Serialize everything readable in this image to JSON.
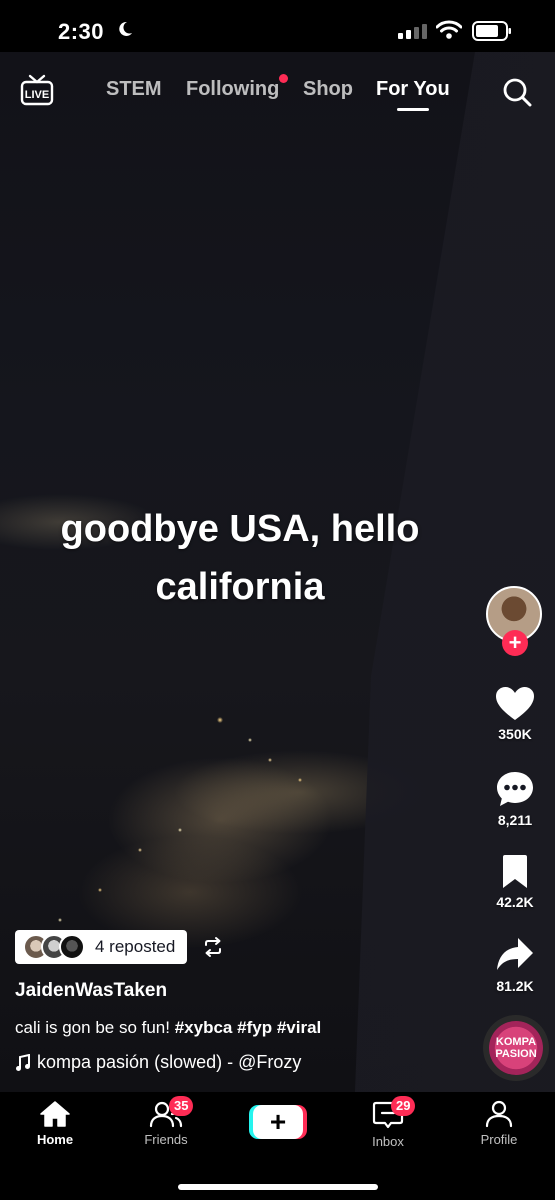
{
  "status_bar": {
    "time": "2:30",
    "moon_icon": "moon-icon"
  },
  "top_nav": {
    "live_label": "LIVE",
    "tabs": [
      {
        "label": "STEM"
      },
      {
        "label": "Following"
      },
      {
        "label": "Shop"
      },
      {
        "label": "For You"
      }
    ],
    "active_tab": "For You"
  },
  "video": {
    "caption_line1": "goodbye USA, hello",
    "caption_line2": "california"
  },
  "actions": {
    "likes": "350K",
    "comments": "8,211",
    "saves": "42.2K",
    "shares": "81.2K"
  },
  "post": {
    "reposted": "4 reposted",
    "username": "JaidenWasTaken",
    "description": "cali is gon be so fun! ",
    "hashtags": [
      "#xybca",
      "#fyp",
      "#viral"
    ],
    "sound": "kompa pasión (slowed) - @Frozy",
    "disc_line1": "KOMPA",
    "disc_line2": "PASION"
  },
  "bottom_nav": {
    "home": "Home",
    "friends": "Friends",
    "friends_badge": "35",
    "create": "+",
    "inbox": "Inbox",
    "inbox_badge": "29",
    "profile": "Profile"
  },
  "colors": {
    "accent": "#fe2c55",
    "cyan": "#25f4ee"
  }
}
